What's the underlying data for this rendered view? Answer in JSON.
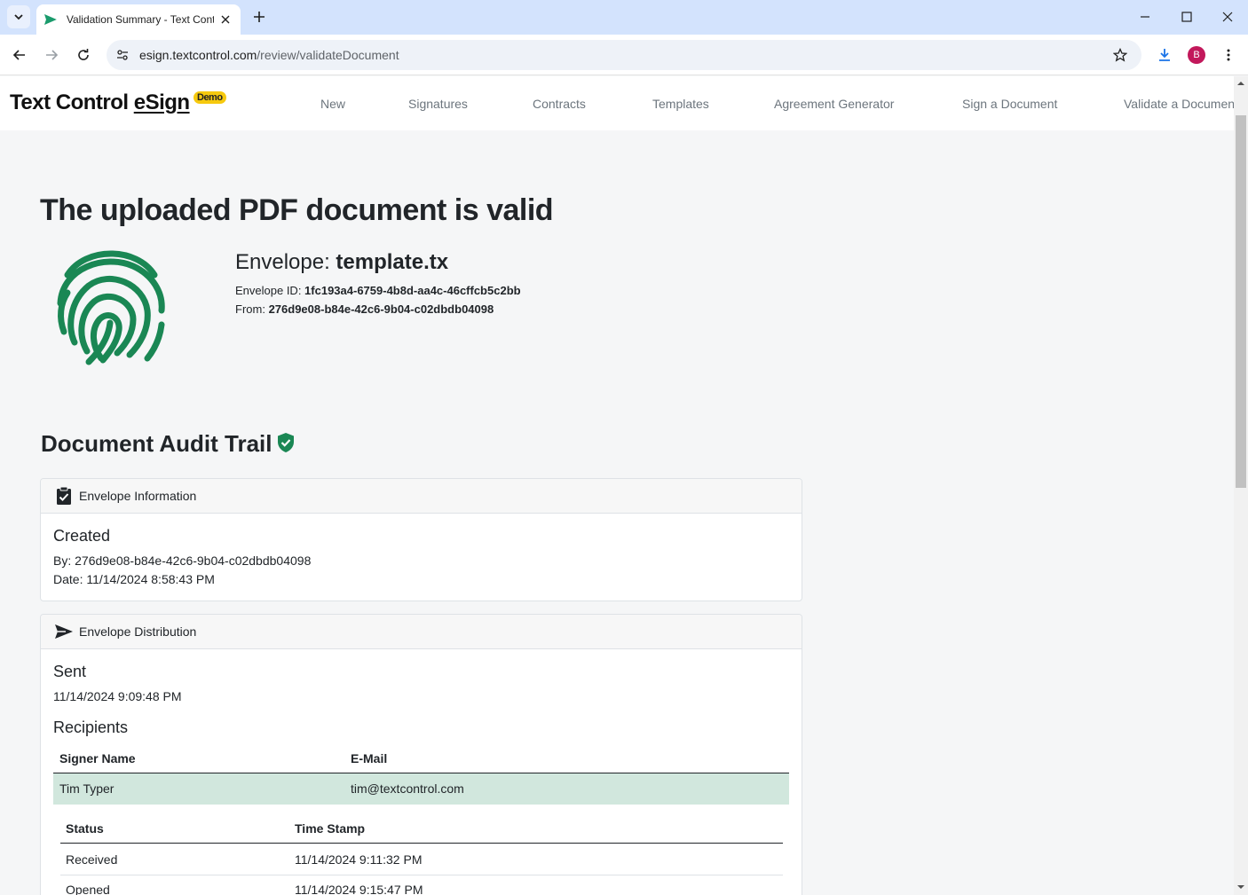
{
  "browser": {
    "tab_title": "Validation Summary - Text Control eSign",
    "url_host": "esign.textcontrol.com",
    "url_path": "/review/validateDocument",
    "profile_initial": "B"
  },
  "site": {
    "brand_main": "Text Control ",
    "brand_esign": "eSign",
    "badge": "Demo",
    "nav": [
      "New",
      "Signatures",
      "Contracts",
      "Templates",
      "Agreement Generator",
      "Sign a Document",
      "Validate a Document"
    ]
  },
  "page": {
    "title": "The uploaded PDF document is valid",
    "envelope_label": "Envelope: ",
    "envelope_name": "template.tx",
    "envelope_id_label": "Envelope ID: ",
    "envelope_id": "1fc193a4-6759-4b8d-aa4c-46cffcb5c2bb",
    "from_label": "From: ",
    "from_value": "276d9e08-b84e-42c6-9b04-c02dbdb04098",
    "audit_title": "Document Audit Trail"
  },
  "envelope_info": {
    "header": "Envelope Information",
    "heading": "Created",
    "by": "By: 276d9e08-b84e-42c6-9b04-c02dbdb04098",
    "date": "Date: 11/14/2024 8:58:43 PM"
  },
  "distribution": {
    "header": "Envelope Distribution",
    "sent_heading": "Sent",
    "sent_date": "11/14/2024 9:09:48 PM",
    "recipients_heading": "Recipients",
    "col_signer": "Signer Name",
    "col_email": "E-Mail",
    "recipient_name": "Tim Typer",
    "recipient_email": "tim@textcontrol.com",
    "col_status": "Status",
    "col_timestamp": "Time Stamp",
    "events": [
      {
        "status": "Received",
        "time": "11/14/2024 9:11:32 PM"
      },
      {
        "status": "Opened",
        "time": "11/14/2024 9:15:47 PM"
      }
    ]
  },
  "colors": {
    "accent_green": "#1a8754",
    "row_highlight": "#d1e7dd",
    "badge_yellow": "#f6c90e"
  }
}
